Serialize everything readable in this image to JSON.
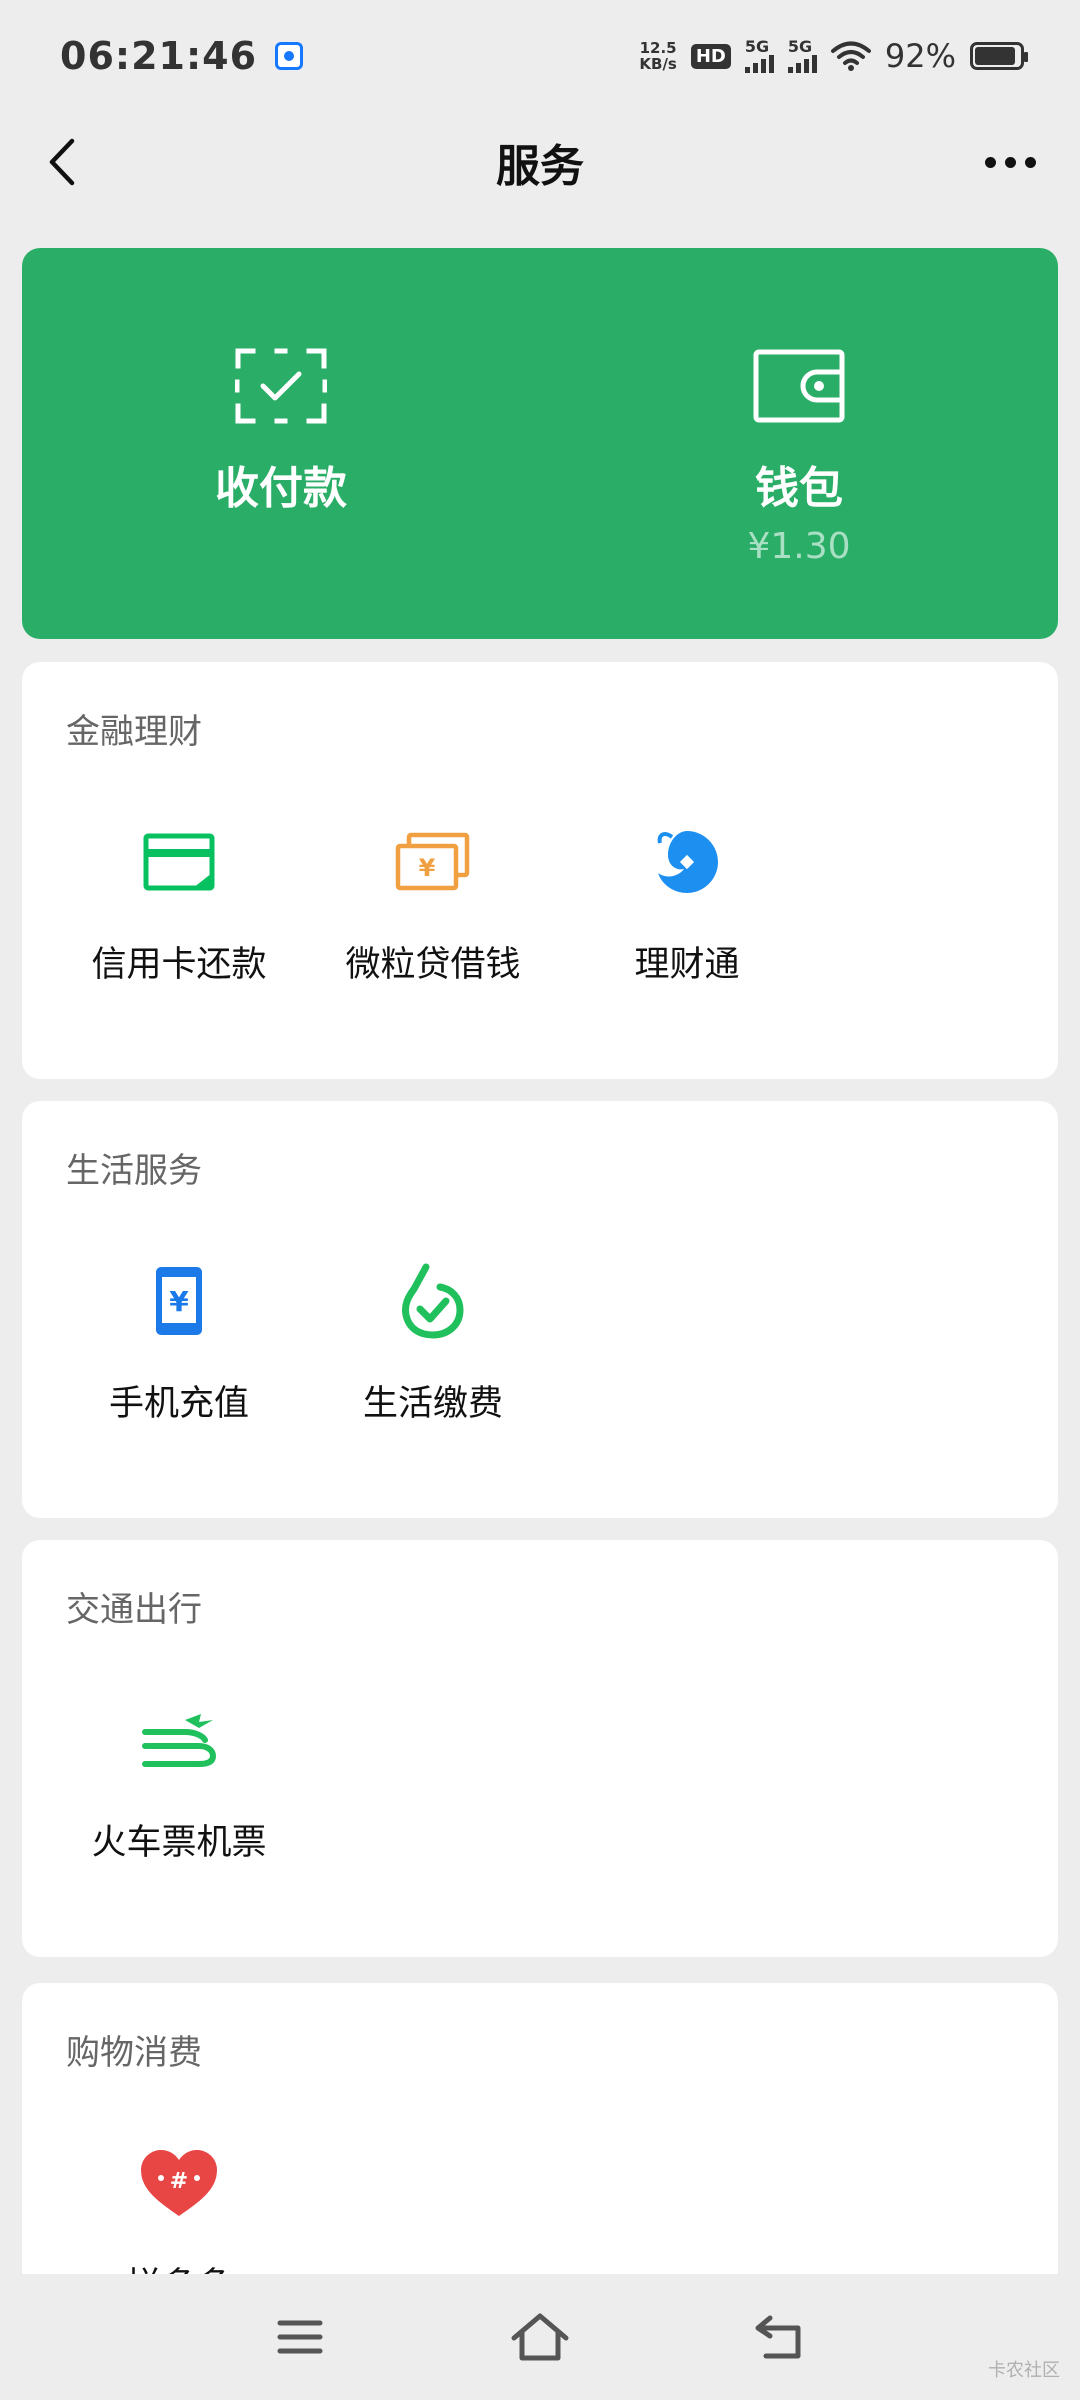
{
  "status_bar": {
    "time": "06:21:46",
    "net_speed_value": "12.5",
    "net_speed_unit": "KB/s",
    "hd_label": "HD",
    "sim1_label": "5G",
    "sim2_label": "5G",
    "battery_percent_text": "92%",
    "battery_level": 0.92
  },
  "header": {
    "title": "服务"
  },
  "pay_card": {
    "color": "#2aae67",
    "items": [
      {
        "label": "收付款",
        "icon": "scan-check-icon"
      },
      {
        "label": "钱包",
        "icon": "wallet-icon",
        "sub": "¥1.30"
      }
    ]
  },
  "sections": [
    {
      "title": "金融理财",
      "items": [
        {
          "label": "信用卡还款",
          "icon": "credit-card-icon",
          "color": "#07c160"
        },
        {
          "label": "微粒贷借钱",
          "icon": "loan-cash-icon",
          "color": "#f0a041"
        },
        {
          "label": "理财通",
          "icon": "wealth-icon",
          "color": "#1c8ff0"
        }
      ]
    },
    {
      "title": "生活服务",
      "items": [
        {
          "label": "手机充值",
          "icon": "phone-recharge-icon",
          "color": "#1c7ae8"
        },
        {
          "label": "生活缴费",
          "icon": "utility-payment-icon",
          "color": "#20c05c"
        }
      ]
    },
    {
      "title": "交通出行",
      "items": [
        {
          "label": "火车票机票",
          "icon": "train-plane-icon",
          "color": "#20c05c"
        }
      ]
    },
    {
      "title": "购物消费",
      "items": [
        {
          "label": "拼多多",
          "icon": "pinduoduo-icon",
          "color": "#e84545"
        }
      ]
    }
  ],
  "system_nav": {
    "buttons": [
      "menu-icon",
      "home-icon",
      "back-return-icon"
    ],
    "watermark": "卡农社区"
  }
}
